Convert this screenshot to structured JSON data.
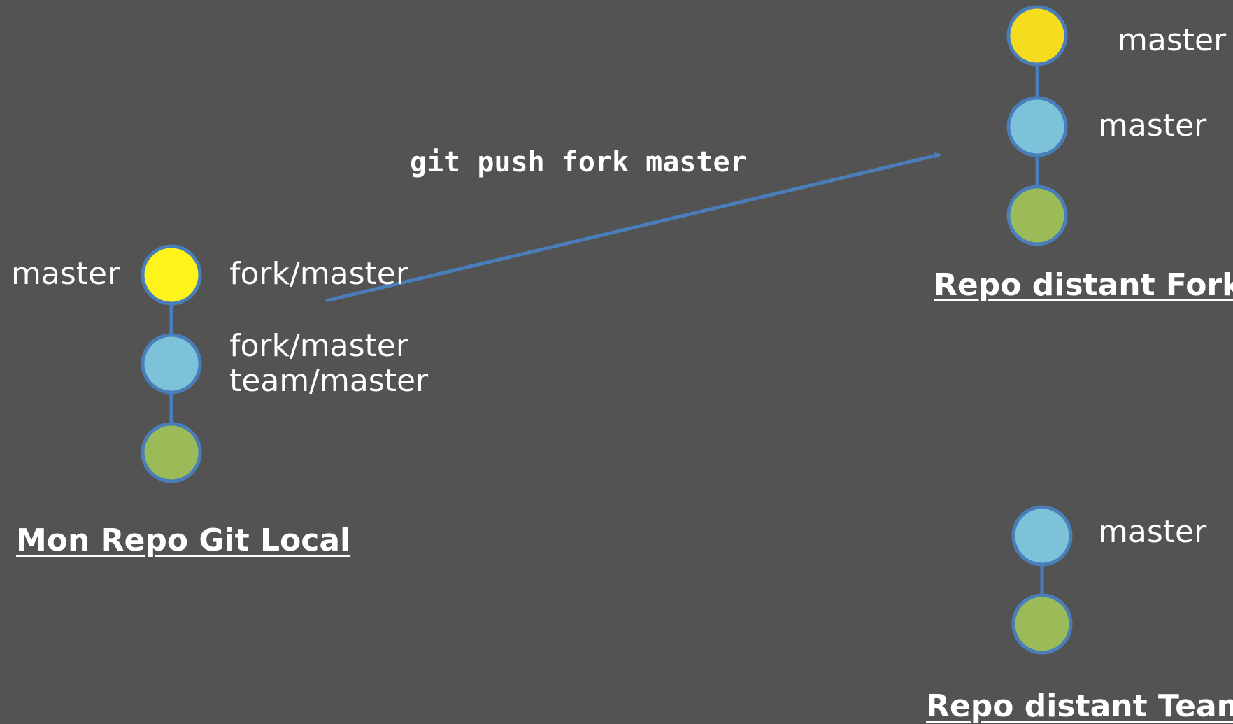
{
  "colors": {
    "background": "#535353",
    "commit_yellow": "#FFF31C",
    "commit_yellow_remote": "#F5DC1E",
    "commit_blue": "#7CC3DA",
    "commit_green": "#9BBB59",
    "stroke": "#4A7EBB",
    "text": "#FFFFFF"
  },
  "command": "git push fork master",
  "local": {
    "title": "Mon Repo Git Local",
    "left_label": "master",
    "commit_labels": [
      "fork/master",
      "fork/master",
      "team/master"
    ]
  },
  "fork": {
    "title": "Repo distant Fork",
    "commit_labels": [
      "master",
      "master"
    ]
  },
  "team": {
    "title": "Repo distant Team",
    "commit_labels": [
      "master"
    ]
  }
}
